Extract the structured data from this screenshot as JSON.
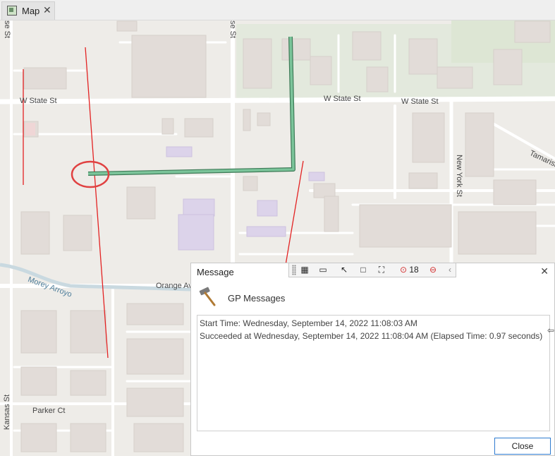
{
  "tab": {
    "label": "Map",
    "close": "✕",
    "icon": "map-icon"
  },
  "map": {
    "streets": {
      "w_state_left": "W State St",
      "w_state_mid": "W State St",
      "w_state_right": "W State St",
      "orange": "Orange Av",
      "parker": "Parker Ct",
      "kansas": "Kansas St",
      "new_york": "New York St",
      "tamarisk": "Tamarisk",
      "morey_arroyo": "Morey Arroyo",
      "se_st_left": "se St",
      "se_st_mid": "se St"
    },
    "colors": {
      "route": "#7bc49a",
      "route_outline": "#3e7a57",
      "selection_line": "#e32222",
      "highlight_circle": "#e04141",
      "building": "#e2dcd8",
      "institution": "#dcd3ea"
    }
  },
  "toolbar": {
    "items": [
      "attribute-table-icon",
      "camera-icon",
      "select-cursor-icon",
      "rectangle-icon",
      "extent-icon",
      "selection-count-icon",
      "clear-selection-icon",
      "chevron-left-icon"
    ],
    "selection_count": "18"
  },
  "dialog": {
    "title": "Message",
    "close": "✕",
    "header": "GP Messages",
    "messages": [
      "Start Time: Wednesday, September 14, 2022 11:08:03 AM",
      "Succeeded at Wednesday, September 14, 2022 11:08:04 AM (Elapsed Time: 0.97 seconds)"
    ],
    "close_button": "Close"
  }
}
